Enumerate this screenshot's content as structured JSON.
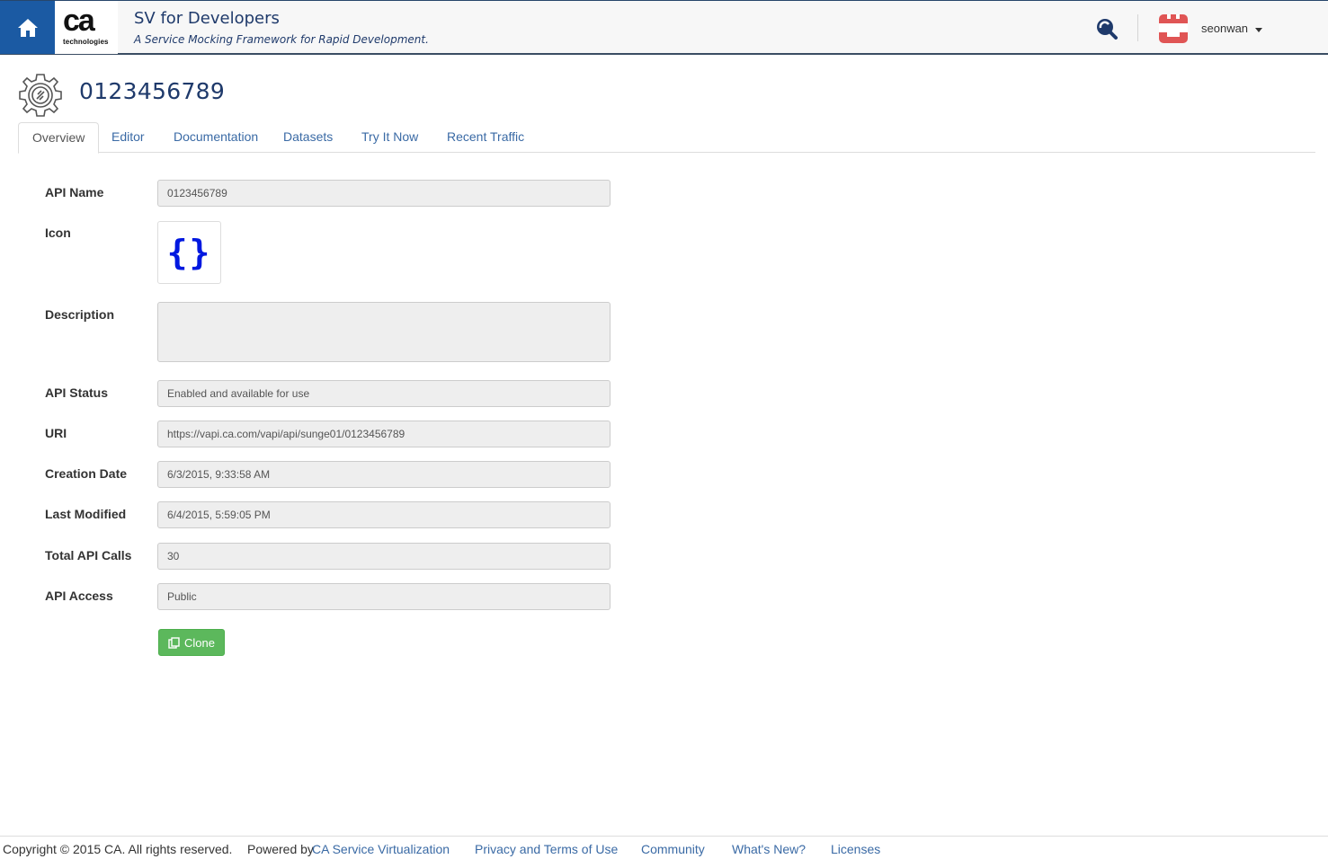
{
  "header": {
    "logo_text": "ca",
    "logo_subtext": "technologies",
    "app_title": "SV for Developers",
    "app_subtitle": "A Service Mocking Framework for Rapid Development.",
    "username": "seonwan"
  },
  "api": {
    "title": "0123456789"
  },
  "tabs": [
    {
      "label": "Overview",
      "active": true
    },
    {
      "label": "Editor"
    },
    {
      "label": "Documentation"
    },
    {
      "label": "Datasets"
    },
    {
      "label": "Try It Now"
    },
    {
      "label": "Recent Traffic"
    }
  ],
  "form": {
    "api_name_label": "API Name",
    "api_name_value": "0123456789",
    "icon_label": "Icon",
    "icon_glyph": "{}",
    "description_label": "Description",
    "description_value": "",
    "status_label": "API Status",
    "status_value": "Enabled and available for use",
    "uri_label": "URI",
    "uri_value": "https://vapi.ca.com/vapi/api/sunge01/0123456789",
    "creation_label": "Creation Date",
    "creation_value": "6/3/2015, 9:33:58 AM",
    "modified_label": "Last Modified",
    "modified_value": "6/4/2015, 5:59:05 PM",
    "calls_label": "Total API Calls",
    "calls_value": "30",
    "access_label": "API Access",
    "access_value": "Public",
    "clone_label": "Clone"
  },
  "footer": {
    "copyright": "Copyright © 2015 CA. All rights reserved.",
    "powered_by": "Powered by",
    "powered_link": "CA Service Virtualization",
    "privacy": "Privacy and Terms of Use",
    "community": "Community",
    "whats_new": "What's New?",
    "licenses": "Licenses"
  },
  "colors": {
    "home_button": "#1b5aa3",
    "title_text": "#1f3a6b",
    "link": "#3a6aa5",
    "clone_button": "#5cb85c",
    "avatar": "#e05555"
  },
  "icons": {
    "home": "home-icon",
    "search": "search-icon",
    "avatar": "avatar-icon",
    "gear": "gear-icon",
    "clone": "copy-icon"
  }
}
